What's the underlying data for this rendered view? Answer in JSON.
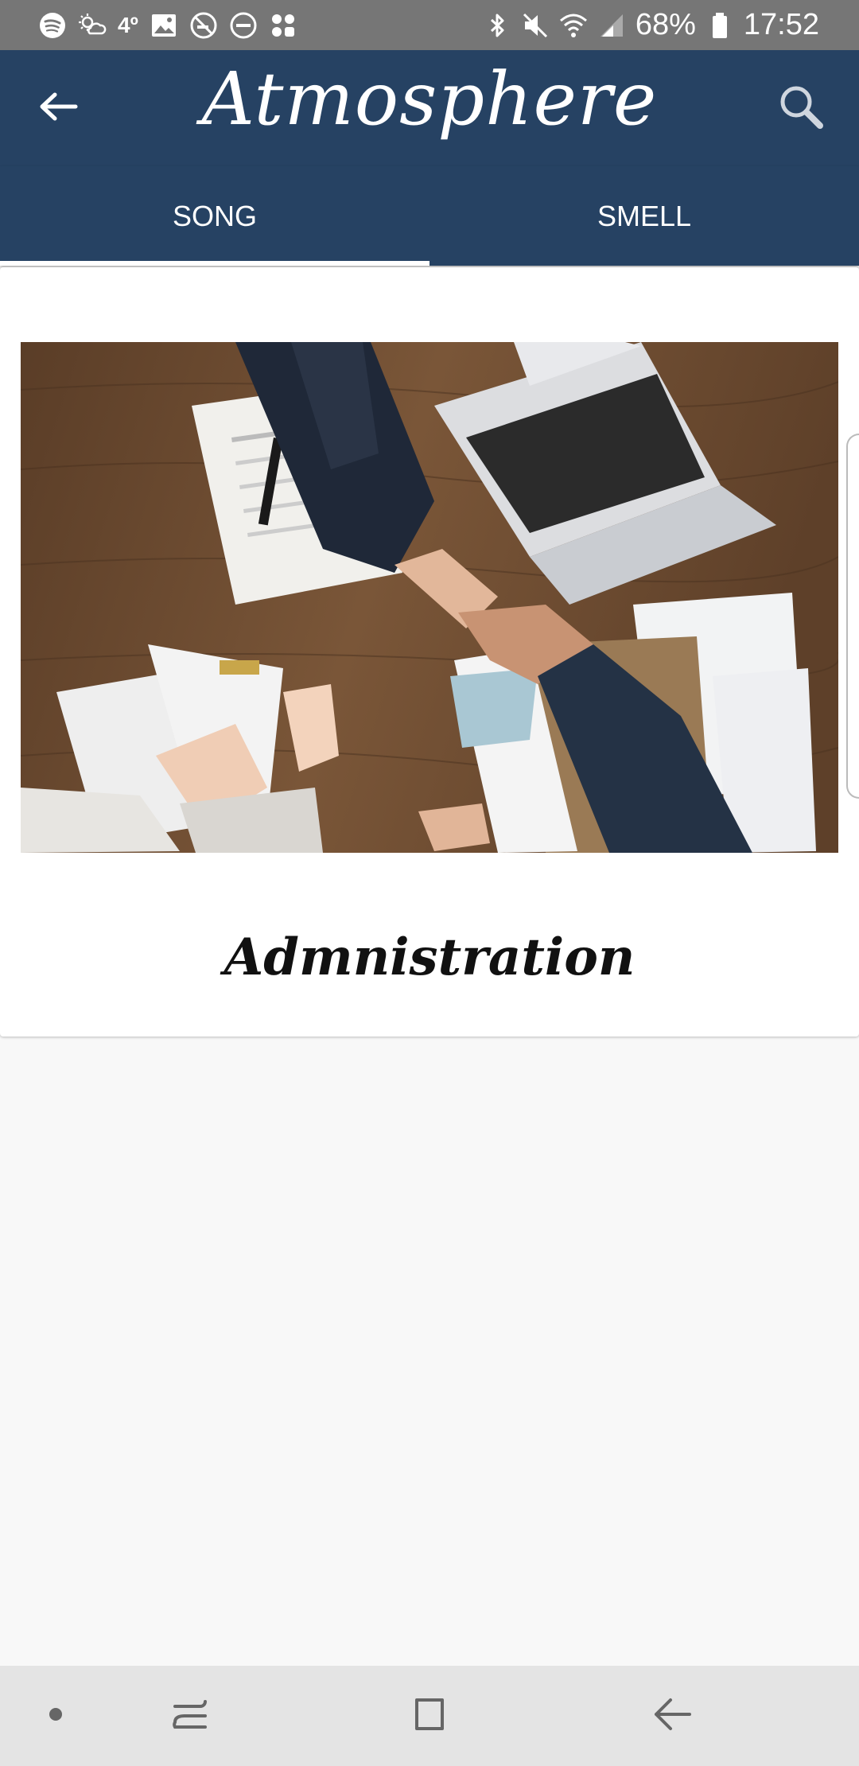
{
  "status_bar": {
    "temperature": "4º",
    "battery": "68%",
    "time": "17:52",
    "left_icons": [
      "spotify-icon",
      "weather-icon",
      "temperature",
      "image-icon",
      "no-smoking-icon",
      "do-not-disturb-icon",
      "apps-icon"
    ],
    "right_icons": [
      "bluetooth-icon",
      "mute-icon",
      "wifi-icon",
      "signal-icon",
      "battery-icon"
    ]
  },
  "app_bar": {
    "title": "Atmosphere",
    "back_icon": "arrow-left-icon",
    "search_icon": "search-icon"
  },
  "tabs": [
    {
      "label": "SONG",
      "selected": true
    },
    {
      "label": "SMELL",
      "selected": false
    }
  ],
  "card": {
    "label": "Admnistration",
    "image": "business-handshake-photo"
  },
  "colors": {
    "primary": "#264263",
    "status_bar": "#767676",
    "nav_bar": "#e4e4e4",
    "background": "#f8f8f8"
  },
  "nav_bar": {
    "icons": [
      "dot-icon",
      "recent-apps-icon",
      "home-icon",
      "back-icon"
    ]
  }
}
